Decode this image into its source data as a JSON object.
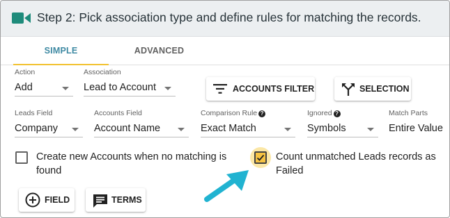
{
  "header": {
    "title": "Step 2: Pick association type and define rules for matching the records.",
    "icon": "video-camera-icon",
    "icon_color": "#1e8b7b"
  },
  "tabs": [
    {
      "label": "SIMPLE",
      "active": true
    },
    {
      "label": "ADVANCED",
      "active": false
    }
  ],
  "row1": {
    "action": {
      "label": "Action",
      "value": "Add"
    },
    "association": {
      "label": "Association",
      "value": "Lead to Account"
    },
    "accounts_filter_button": "ACCOUNTS FILTER",
    "selection_button": "SELECTION"
  },
  "row2": {
    "leads_field": {
      "label": "Leads Field",
      "value": "Company"
    },
    "accounts_field": {
      "label": "Accounts Field",
      "value": "Account Name"
    },
    "comparison_rule": {
      "label": "Comparison Rule",
      "value": "Exact Match"
    },
    "ignored": {
      "label": "Ignored",
      "value": "Symbols"
    },
    "match_parts": {
      "label": "Match Parts",
      "value": "Entire Value"
    }
  },
  "options": {
    "create_accounts": {
      "line1": "Create new Accounts when no matching is",
      "line2": "found",
      "checked": false
    },
    "count_unmatched": {
      "line1": "Count unmatched Leads records as",
      "line2": "Failed",
      "checked": true
    }
  },
  "bottom_buttons": {
    "field": "FIELD",
    "terms": "TERMS"
  },
  "colors": {
    "accent_tab": "#3f8aa3",
    "tab_underline": "#f2c230",
    "checkbox_checked": "#f6c343",
    "callout_arrow": "#21b3d1"
  }
}
